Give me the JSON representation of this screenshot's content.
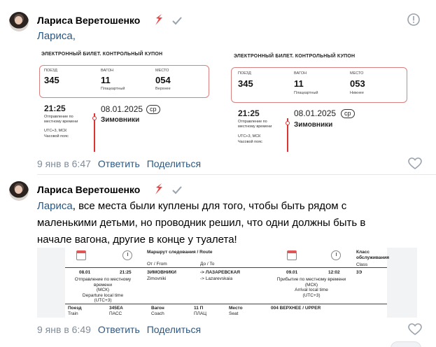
{
  "comments": [
    {
      "author": "Лариса Веретошенко",
      "text_mention": "Лариса,",
      "text_rest": "",
      "date": "9 янв в 6:47",
      "reply_label": "Ответить",
      "share_label": "Поделиться",
      "tickets": [
        {
          "title": "ЭЛЕКТРОННЫЙ БИЛЕТ. КОНТРОЛЬНЫЙ КУПОН",
          "train_label": "ПОЕЗД",
          "train": "345",
          "car_label": "ВАГОН",
          "car": "11",
          "car_type": "Плацкартный",
          "seat_label": "МЕСТО",
          "seat": "054",
          "seat_type": "Верхнее",
          "time": "21:25",
          "date": "08.01.2025",
          "cp": "ср",
          "depart_note": "Отправление по местному времени",
          "tz": "UTC+3, МСК",
          "tz_label": "Часовой пояс",
          "station": "Зимовники"
        },
        {
          "title": "ЭЛЕКТРОННЫЙ БИЛЕТ. КОНТРОЛЬНЫЙ КУПОН",
          "train_label": "ПОЕЗД",
          "train": "345",
          "car_label": "ВАГОН",
          "car": "11",
          "car_type": "Плацкартный",
          "seat_label": "МЕСТО",
          "seat": "053",
          "seat_type": "Нижнее",
          "time": "21:25",
          "date": "08.01.2025",
          "cp": "ср",
          "depart_note": "Отправление по местному времени",
          "tz": "UTC+3, МСК",
          "tz_label": "Часовой пояс",
          "station": "Зимовники"
        }
      ]
    },
    {
      "author": "Лариса Веретошенко",
      "text_mention": "Лариса",
      "text_rest_1": ", все места были куплены для того, чтобы быть рядом с",
      "text_line_2": "маленькими детьми, но проводник решил, что одни должны быть в",
      "text_line_3": "начале вагона, другие в конце у туалета!",
      "date": "9 янв в 6:49",
      "reply_label": "Ответить",
      "share_label": "Поделиться",
      "route_ticket": {
        "route_header": "Маршрут следования / Route",
        "from_label": "От / From",
        "to_label": "До / To",
        "class_label": "Класс обслуживания",
        "class_en": "Class",
        "dep_date": "08.01",
        "dep_time": "21:25",
        "from_ru": "ЗИМОВНИКИ",
        "from_en": "Zimovniki",
        "to_ru": "-> ЛАЗАРЕВСКАЯ",
        "to_en": "-> Lazarevskaia",
        "arr_date": "09.01",
        "arr_time": "12:02",
        "class_val": "3Э",
        "dep_note_ru": "Отправление по местному времени",
        "dep_note_msk": "(МСК)",
        "dep_note_en": "Departure local time",
        "dep_note_utc": "(UTC+3)",
        "arr_note_ru": "Прибытие по местному времени",
        "arr_note_msk": "(МСК)",
        "arr_note_en": "Arrival local time",
        "arr_note_utc": "(UTC+3)",
        "train_label": "Поезд",
        "train_en": "Train",
        "train_val": "345ЕА",
        "train_sub": "ПАСС",
        "car_label": "Вагон",
        "car_en": "Coach",
        "car_val": "11 П",
        "car_sub": "ПЛАЦ",
        "seat_label": "Место",
        "seat_en": "Seat",
        "seat_val": "004 ВЕРХНЕЕ / UPPER"
      }
    }
  ],
  "colors": {
    "link": "#2a5885",
    "meta": "#818c99",
    "verified": "#e64646",
    "ticket_red": "#d33333"
  },
  "icons": [
    "verified-icon",
    "check-icon",
    "report-icon",
    "like-icon",
    "calendar-icon",
    "clock-icon"
  ]
}
